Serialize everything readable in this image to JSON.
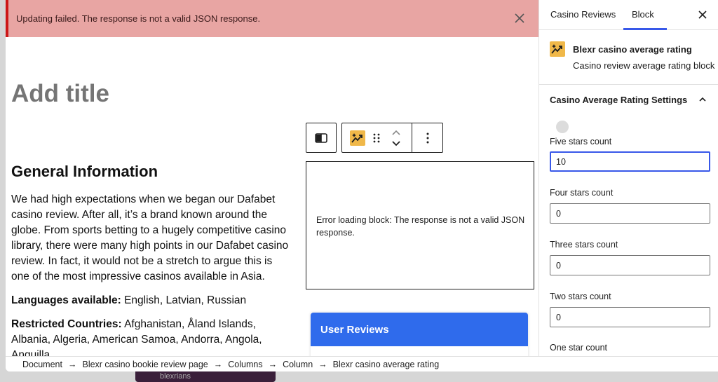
{
  "notice": {
    "message": "Updating failed. The response is not a valid JSON response."
  },
  "editor": {
    "title_placeholder": "Add title",
    "heading": "General Information",
    "intro": "We had high expectations when we began our Dafabet casino review. After all, it’s a brand known around the globe. From sports betting to a hugely competitive casino library, there were many high points in our Dafabet casino review. In fact, it would not be a stretch to argue this is one of the most impressive casinos available in Asia.",
    "languages_label": "Languages available:",
    "languages_value": " English, Latvian, Russian",
    "restricted_label": "Restricted Countries:",
    "restricted_value": " Afghanistan, Åland Islands, Albania, Algeria, American Samoa, Andorra, Angola, Anguilla",
    "error_message": "Error loading block: The response is not a valid JSON response.",
    "user_reviews_title": "User Reviews"
  },
  "breadcrumb": [
    "Document",
    "Blexr casino bookie review page",
    "Columns",
    "Column",
    "Blexr casino average rating"
  ],
  "sidebar": {
    "tabs": [
      {
        "label": "Casino Reviews",
        "active": false
      },
      {
        "label": "Block",
        "active": true
      }
    ],
    "block_card": {
      "title": "Blexr casino average rating",
      "description": "Casino review average rating block"
    },
    "panel_title": "Casino Average Rating Settings",
    "fields": [
      {
        "label": "Five stars count",
        "value": "10",
        "focused": true
      },
      {
        "label": "Four stars count",
        "value": "0",
        "focused": false
      },
      {
        "label": "Three stars count",
        "value": "0",
        "focused": false
      },
      {
        "label": "Two stars count",
        "value": "0",
        "focused": false
      },
      {
        "label": "One star count",
        "value": "",
        "focused": false
      }
    ]
  },
  "background": {
    "taskbar_text": "blexrians"
  },
  "colors": {
    "accent": "#3858e9",
    "notice_bg": "#e8a5a3",
    "block_icon": "#f0b849",
    "user_reviews_header": "#2f6bec"
  }
}
